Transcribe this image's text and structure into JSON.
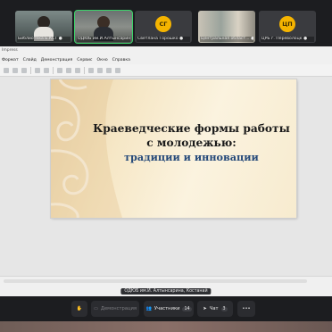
{
  "participants": [
    {
      "name": "Библиотека Б.КСТ",
      "kind": "video"
    },
    {
      "name": "ОДЮБ им.И.Алтынсарин",
      "kind": "video",
      "active": true
    },
    {
      "name": "Светлана Горошко",
      "kind": "avatar",
      "initials": "СГ",
      "avatar_color": "#f5b400"
    },
    {
      "name": "Центральная област...",
      "kind": "video"
    },
    {
      "name": "ЦРБ г. Переволоцк",
      "kind": "avatar",
      "initials": "ЦП",
      "avatar_color": "#f5b400"
    }
  ],
  "app": {
    "title": "Impress",
    "menu": [
      "Формат",
      "Слайд",
      "Демонстрация",
      "Сервис",
      "Окно",
      "Справка"
    ]
  },
  "slide": {
    "line1": "Краеведческие формы работы",
    "line2": "с молодежью:",
    "line3": "традиции и инновации"
  },
  "speaker_label": "ОДЮБ им.И. Алтынсарина, Костанай",
  "controls": {
    "hand_icon": "raise-hand-icon",
    "present_label": "Демонстрация",
    "participants_label": "Участники",
    "participants_count": "14",
    "chat_label": "Чат",
    "chat_count": "3",
    "more_icon": "more-icon"
  }
}
